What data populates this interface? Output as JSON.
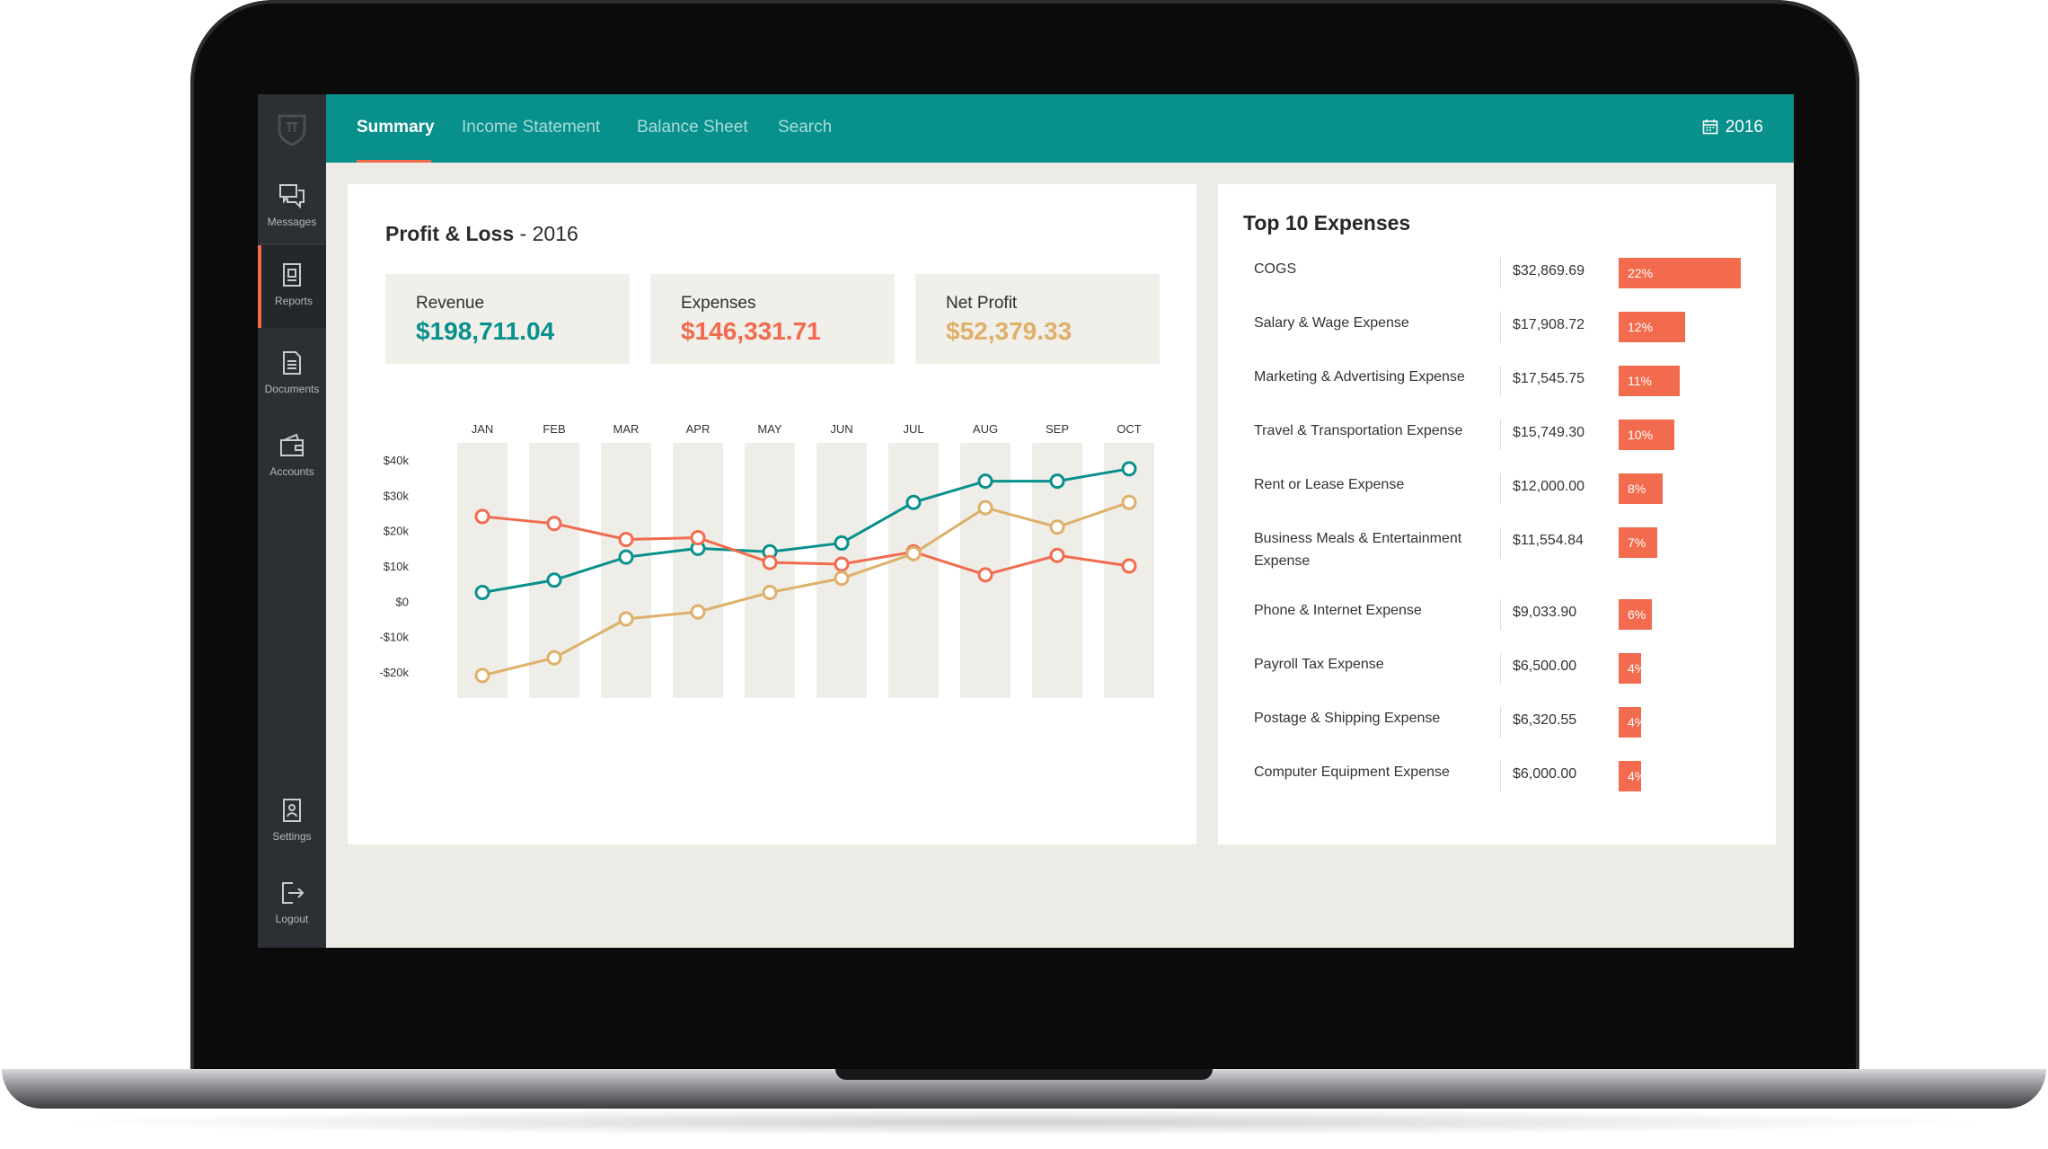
{
  "nav": {
    "tabs": [
      "Summary",
      "Income Statement",
      "Balance Sheet",
      "Search"
    ],
    "year": "2016"
  },
  "sidebar": {
    "items": [
      {
        "label": "Messages",
        "icon": "messages-icon"
      },
      {
        "label": "Reports",
        "icon": "reports-icon",
        "active": true
      },
      {
        "label": "Documents",
        "icon": "documents-icon"
      },
      {
        "label": "Accounts",
        "icon": "wallet-icon"
      },
      {
        "label": "Settings",
        "icon": "settings-icon"
      },
      {
        "label": "Logout",
        "icon": "logout-icon"
      }
    ]
  },
  "pl": {
    "title": "Profit & Loss",
    "year_suffix": " - 2016",
    "stats": [
      {
        "label": "Revenue",
        "value": "$198,711.04",
        "color": "#08908c"
      },
      {
        "label": "Expenses",
        "value": "$146,331.71",
        "color": "#f26b4e"
      },
      {
        "label": "Net Profit",
        "value": "$52,379.33",
        "color": "#deb06a"
      }
    ]
  },
  "chart_data": {
    "type": "line",
    "categories": [
      "JAN",
      "FEB",
      "MAR",
      "APR",
      "MAY",
      "JUN",
      "JUL",
      "AUG",
      "SEP",
      "OCT"
    ],
    "yticks": [
      "$40k",
      "$30k",
      "$20k",
      "$10k",
      "$0",
      "-$10k",
      "-$20k"
    ],
    "ylim": [
      -20,
      40
    ],
    "series": [
      {
        "color": "#08908c",
        "values": [
          2.5,
          6,
          12.5,
          15,
          14,
          16.5,
          28,
          34,
          34,
          37.5
        ]
      },
      {
        "color": "#f26b4e",
        "values": [
          24,
          22,
          17.5,
          18,
          11,
          10.5,
          14,
          7.5,
          13,
          10
        ]
      },
      {
        "color": "#deb06a",
        "values": [
          -21,
          -16,
          -5,
          -3,
          2.5,
          6.5,
          13.5,
          26.5,
          21,
          28
        ]
      }
    ]
  },
  "expenses": {
    "title": "Top 10 Expenses",
    "items": [
      {
        "name": "COGS",
        "amount": "$32,869.69",
        "pct": "22%",
        "share": 22
      },
      {
        "name": "Salary & Wage Expense",
        "amount": "$17,908.72",
        "pct": "12%",
        "share": 12
      },
      {
        "name": "Marketing & Advertising Expense",
        "amount": "$17,545.75",
        "pct": "11%",
        "share": 11
      },
      {
        "name": "Travel & Transportation Expense",
        "amount": "$15,749.30",
        "pct": "10%",
        "share": 10
      },
      {
        "name": "Rent or Lease Expense",
        "amount": "$12,000.00",
        "pct": "8%",
        "share": 8
      },
      {
        "name": "Business Meals & Entertainment Expense",
        "amount": "$11,554.84",
        "pct": "7%",
        "share": 7
      },
      {
        "name": "Phone & Internet Expense",
        "amount": "$9,033.90",
        "pct": "6%",
        "share": 6
      },
      {
        "name": "Payroll Tax Expense",
        "amount": "$6,500.00",
        "pct": "4%",
        "share": 4
      },
      {
        "name": "Postage & Shipping Expense",
        "amount": "$6,320.55",
        "pct": "4%",
        "share": 4
      },
      {
        "name": "Computer Equipment Expense",
        "amount": "$6,000.00",
        "pct": "4%",
        "share": 4
      }
    ]
  }
}
